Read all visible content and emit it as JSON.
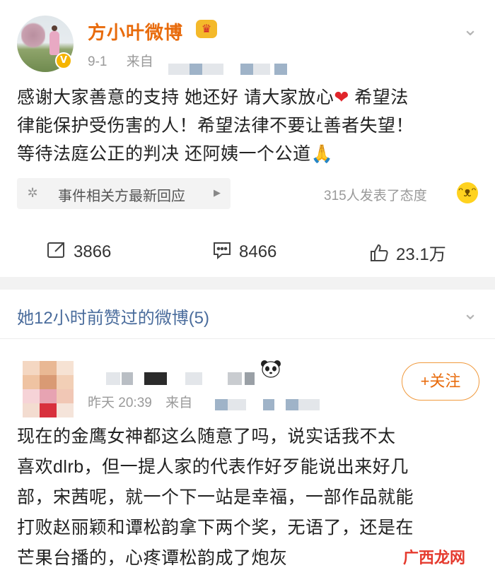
{
  "post1": {
    "author": "方小叶微博",
    "crown_icon": "crown-icon",
    "verified_icon": "verified-v-icon",
    "date": "9-1",
    "source_prefix": "来自",
    "text_lines": [
      "感谢大家善意的支持 她还好 请大家放心",
      "❤",
      " 希望法",
      "律能保护受伤害的人！希望法律不要让善者失望！",
      "等待法庭公正的判决 还阿姨一个公道",
      "🙏"
    ],
    "topic_label": "事件相关方最新回应",
    "attitude_text": "315人发表了态度",
    "actions": {
      "repost_count": "3866",
      "comment_count": "8466",
      "like_count": "23.1万"
    }
  },
  "liked_header": {
    "title": "她12小时前赞过的微博(5)"
  },
  "post2": {
    "time": "昨天 20:39",
    "source_prefix": "来自",
    "follow_label": "+关注",
    "text_lines": [
      "现在的金鹰女神都这么随意了吗，说实话我不太",
      "喜欢dlrb，但一提人家的代表作好歹能说出来好几",
      "部，宋茜呢，就一个下一站是幸福，一部作品就能",
      "打败赵丽颖和谭松韵拿下两个奖，无语了，还是在",
      "芒果台播的，心疼谭松韵成了炮灰"
    ]
  },
  "watermark": "广西龙网",
  "colors": {
    "author_orange": "#e86b0c",
    "link_blue": "#4a6c9c",
    "heart_red": "#e0252b"
  }
}
